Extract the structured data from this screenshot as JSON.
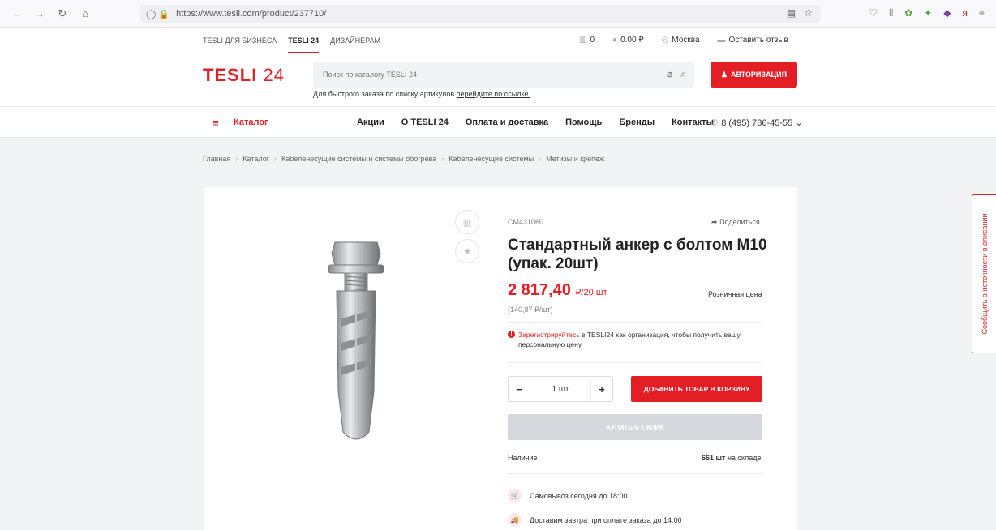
{
  "browser": {
    "url": "https://www.tesli.com/product/237710/"
  },
  "topbar": {
    "links": [
      "TESLI ДЛЯ БИЗНЕСА",
      "TESLI 24",
      "ДИЗАЙНЕРАМ"
    ],
    "compare_count": "0",
    "cart_sum": "0.00 ₽",
    "city": "Москва",
    "feedback": "Оставить отзыв"
  },
  "header": {
    "logo_text": "TESLI",
    "logo_num": "24",
    "search_placeholder": "Поиск по каталогу TESLI 24",
    "search_hint": "Для быстрого заказа по списку артикулов",
    "search_hint_link": "перейдите по ссылке.",
    "auth_label": "АВТОРИЗАЦИЯ"
  },
  "nav": {
    "catalog": "Каталог",
    "items": [
      "Акции",
      "О TESLI 24",
      "Оплата и доставка",
      "Помощь",
      "Бренды",
      "Контакты"
    ],
    "phone": "8 (495) 786-45-55"
  },
  "breadcrumb": [
    "Главная",
    "Каталог",
    "Кабеленесущие системы и системы обогрева",
    "Кабеленесущие системы",
    "Метизы и крепеж"
  ],
  "product": {
    "sku": "CM431060",
    "share": "Поделиться",
    "title": "Стандартный анкер с болтом M10 (упак. 20шт)",
    "price": "2 817,40",
    "price_unit": "₽/20 шт",
    "retail_label": "Розничная цена",
    "unit_price": "(140,87 ₽/шт)",
    "notice_link": "Зарегистрируйтесь",
    "notice_text": " в TESLI24 как организация, чтобы получить вашу персональную цену",
    "qty": "1 шт",
    "add_to_cart": "ДОБАВИТЬ ТОВАР В КОРЗИНУ",
    "one_click": "КУПИТЬ В 1 КЛИК",
    "availability_label": "Наличие",
    "availability_count": "661 шт",
    "availability_suffix": " на складе",
    "pickup": "Самовывоз сегодня до 18:00",
    "delivery": "Доставим завтра при оплате заказа до 14:00"
  },
  "side_tab": "Сообщить о неточности в описании"
}
